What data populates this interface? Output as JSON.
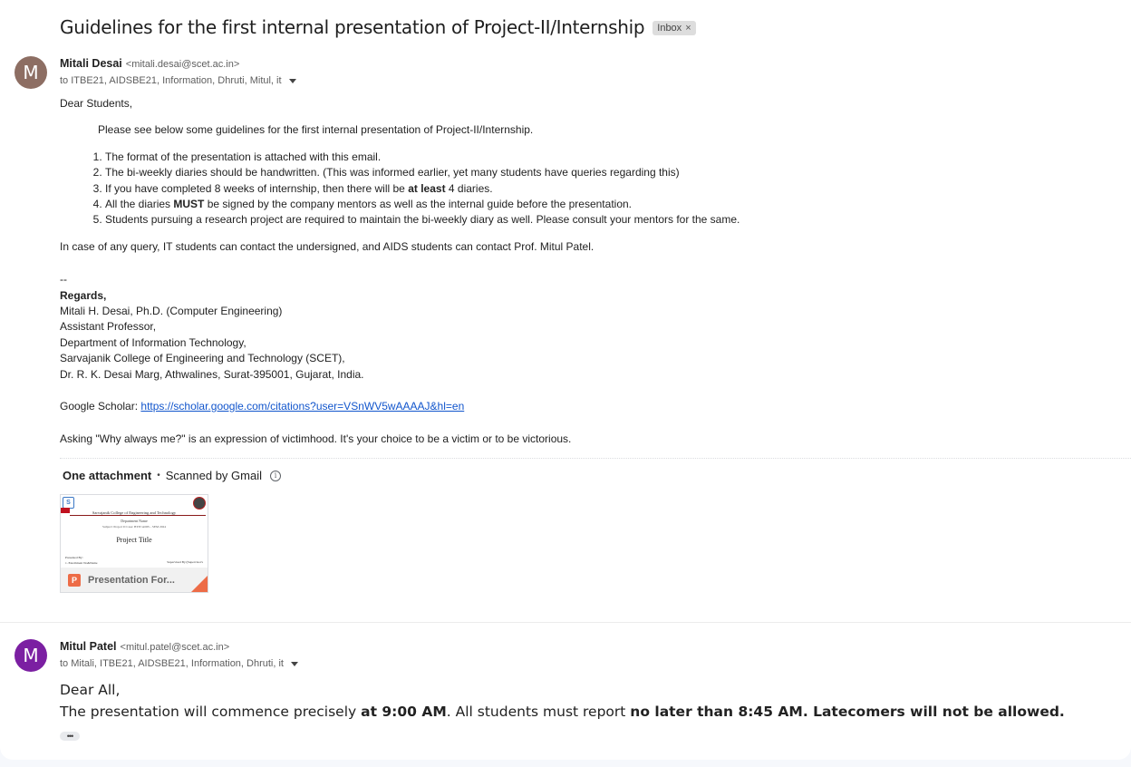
{
  "subject": "Guidelines for the first internal presentation of Project-II/Internship",
  "label_chip": {
    "text": "Inbox",
    "close": "×"
  },
  "message1": {
    "avatar_letter": "M",
    "avatar_color": "#8d6e63",
    "sender_name": "Mitali Desai",
    "sender_email": "<mitali.desai@scet.ac.in>",
    "recipients": "to ITBE21, AIDSBE21, Information, Dhruti, Mitul, it",
    "greeting": "Dear Students,",
    "intro": "Please see below some guidelines for the first internal presentation of Project-II/Internship.",
    "items": {
      "i1": "The format of the presentation is attached with this email.",
      "i2": "The bi-weekly diaries should be handwritten. (This was informed earlier, yet many students have queries regarding this)",
      "i3_pre": "If you have completed 8 weeks of internship, then there will be ",
      "i3_bold": "at least",
      "i3_post": " 4 diaries.",
      "i4_pre": "All the diaries ",
      "i4_bold": "MUST",
      "i4_post": " be signed by the company mentors as well as the internal guide before the presentation.",
      "i5": "Students pursuing a research project are required to maintain the bi-weekly diary as well. Please consult your mentors for the same."
    },
    "query_text": "In case of any query, IT students can contact the undersigned, and AIDS students can contact Prof. Mitul Patel.",
    "signature": {
      "dashes": "--",
      "regards": "Regards,",
      "l1": "Mitali H. Desai, Ph.D. (Computer Engineering)",
      "l2": "Assistant Professor,",
      "l3": "Department of Information Technology,",
      "l4": "Sarvajanik College of Engineering and Technology (SCET),",
      "l5": "Dr. R. K. Desai Marg, Athwalines, Surat-395001, Gujarat, India.",
      "scholar_label": "Google Scholar: ",
      "scholar_url": "https://scholar.google.com/citations?user=VSnWV5wAAAAJ&hl=en",
      "quote": "Asking \"Why always me?\" is an expression of victimhood. It's your choice to be a victim or to be victorious."
    },
    "attachments": {
      "count_label": "One attachment",
      "separator": "•",
      "scan_label": "Scanned by Gmail",
      "info_glyph": "i",
      "file": {
        "name": "Presentation For...",
        "icon_letter": "P",
        "preview": {
          "logo_left": "S",
          "college": "Sarvajanik College of Engineering and Technology",
          "department": "Department Name",
          "subject_line": "Subject: Project II      Case: BTIT/AIDS - SEM 2024",
          "title": "Project Title",
          "presented_by": "Presented By:",
          "student": "1.  Enrollment No&Name",
          "supervised_by": "Supervised By:(Supervisor's"
        }
      }
    }
  },
  "message2": {
    "avatar_letter": "M",
    "avatar_color": "#7b1fa2",
    "sender_name": "Mitul Patel",
    "sender_email": "<mitul.patel@scet.ac.in>",
    "recipients": "to Mitali, ITBE21, AIDSBE21, Information, Dhruti, it",
    "greeting": "Dear All,",
    "text_pre": "The presentation will commence precisely ",
    "bold1": "at 9:00 AM",
    "text_mid": ". All students must report ",
    "bold2": "no later than 8:45 AM. Latecomers will not be allowed.",
    "more_glyph": "•••"
  }
}
